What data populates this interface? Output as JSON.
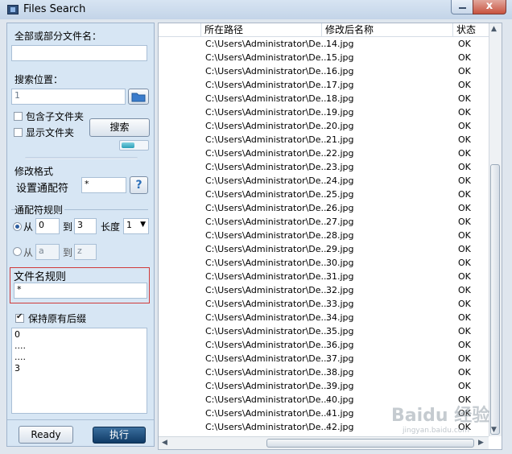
{
  "window": {
    "title": "Files Search",
    "close_glyph": "x"
  },
  "left": {
    "name_label": "全部或部分文件名：",
    "name_value": "",
    "location_label": "搜索位置：",
    "location_value": "1",
    "include_subfolders": "包含子文件夹",
    "show_folders": "显示文件夹",
    "search_button": "搜索",
    "format_group": "修改格式",
    "wildcard_label": "设置通配符",
    "wildcard_value": "*",
    "help_glyph": "?",
    "rule_group": "通配符规则",
    "from1": "从",
    "from1_value": "0",
    "to1": "到",
    "to1_value": "3",
    "length_label": "长度",
    "length_value": "1",
    "from2": "从",
    "from2_value": "a",
    "to2": "到",
    "to2_value": "z",
    "filename_rule_label": "文件名规则",
    "filename_rule_value": "*",
    "keep_ext": "保持原有后缀",
    "preview_lines": [
      "0",
      "....",
      "....",
      "3"
    ],
    "ready_button": "Ready",
    "execute_button": "执行"
  },
  "grid": {
    "columns": [
      "所在路径",
      "修改后名称",
      "状态"
    ],
    "rows": [
      [
        "C:\\Users\\Administrator\\De...",
        "14.jpg",
        "OK"
      ],
      [
        "C:\\Users\\Administrator\\De...",
        "15.jpg",
        "OK"
      ],
      [
        "C:\\Users\\Administrator\\De...",
        "16.jpg",
        "OK"
      ],
      [
        "C:\\Users\\Administrator\\De...",
        "17.jpg",
        "OK"
      ],
      [
        "C:\\Users\\Administrator\\De...",
        "18.jpg",
        "OK"
      ],
      [
        "C:\\Users\\Administrator\\De...",
        "19.jpg",
        "OK"
      ],
      [
        "C:\\Users\\Administrator\\De...",
        "20.jpg",
        "OK"
      ],
      [
        "C:\\Users\\Administrator\\De...",
        "21.jpg",
        "OK"
      ],
      [
        "C:\\Users\\Administrator\\De...",
        "22.jpg",
        "OK"
      ],
      [
        "C:\\Users\\Administrator\\De...",
        "23.jpg",
        "OK"
      ],
      [
        "C:\\Users\\Administrator\\De...",
        "24.jpg",
        "OK"
      ],
      [
        "C:\\Users\\Administrator\\De...",
        "25.jpg",
        "OK"
      ],
      [
        "C:\\Users\\Administrator\\De...",
        "26.jpg",
        "OK"
      ],
      [
        "C:\\Users\\Administrator\\De...",
        "27.jpg",
        "OK"
      ],
      [
        "C:\\Users\\Administrator\\De...",
        "28.jpg",
        "OK"
      ],
      [
        "C:\\Users\\Administrator\\De...",
        "29.jpg",
        "OK"
      ],
      [
        "C:\\Users\\Administrator\\De...",
        "30.jpg",
        "OK"
      ],
      [
        "C:\\Users\\Administrator\\De...",
        "31.jpg",
        "OK"
      ],
      [
        "C:\\Users\\Administrator\\De...",
        "32.jpg",
        "OK"
      ],
      [
        "C:\\Users\\Administrator\\De...",
        "33.jpg",
        "OK"
      ],
      [
        "C:\\Users\\Administrator\\De...",
        "34.jpg",
        "OK"
      ],
      [
        "C:\\Users\\Administrator\\De...",
        "35.jpg",
        "OK"
      ],
      [
        "C:\\Users\\Administrator\\De...",
        "36.jpg",
        "OK"
      ],
      [
        "C:\\Users\\Administrator\\De...",
        "37.jpg",
        "OK"
      ],
      [
        "C:\\Users\\Administrator\\De...",
        "38.jpg",
        "OK"
      ],
      [
        "C:\\Users\\Administrator\\De...",
        "39.jpg",
        "OK"
      ],
      [
        "C:\\Users\\Administrator\\De...",
        "40.jpg",
        "OK"
      ],
      [
        "C:\\Users\\Administrator\\De...",
        "41.jpg",
        "OK"
      ],
      [
        "C:\\Users\\Administrator\\De...",
        "42.jpg",
        "OK"
      ]
    ]
  },
  "watermark": {
    "text": "Baidu 经验",
    "sub": "jingyan.baidu.com"
  }
}
